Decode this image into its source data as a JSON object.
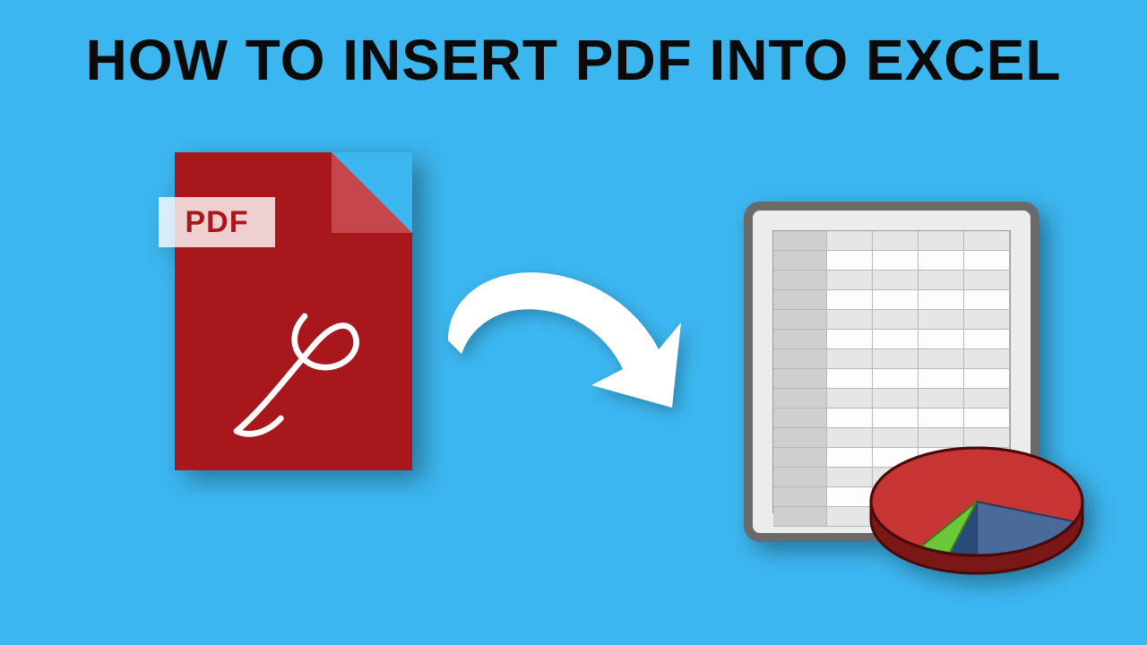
{
  "title": "HOW TO INSERT PDF INTO EXCEL",
  "pdf_badge_label": "PDF",
  "colors": {
    "background": "#3cb6ef",
    "pdf_body": "#a8171c",
    "pdf_fold": "#c5474b",
    "arrow": "#ffffff",
    "spreadsheet_frame": "#6a6a6a",
    "pie_red": "#c73434",
    "pie_blue": "#4a6a9a",
    "pie_green": "#6ac83a"
  },
  "spreadsheet": {
    "rows": 15,
    "cols": 5
  }
}
